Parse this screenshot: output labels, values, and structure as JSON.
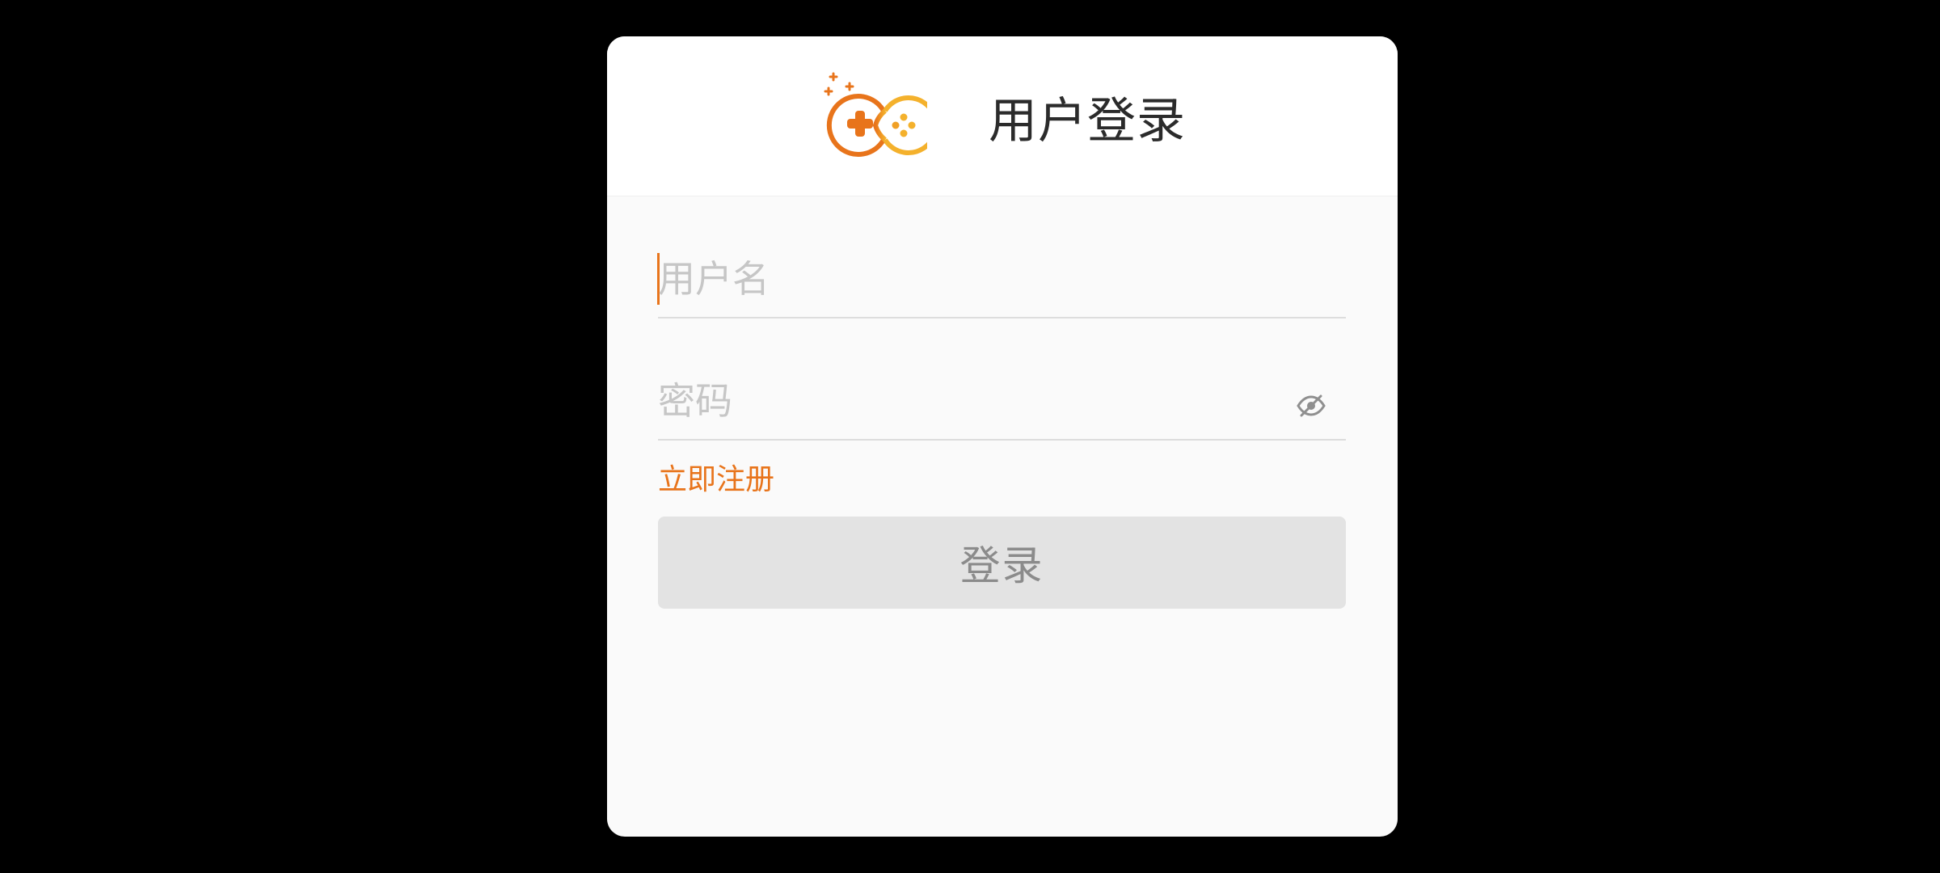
{
  "dialog": {
    "title": "用户登录",
    "logo_icon": "game-controller-logo-icon"
  },
  "form": {
    "username_placeholder": "用户名",
    "password_placeholder": "密码",
    "password_visibility_icon": "eye-off-icon",
    "register_label": "立即注册",
    "login_label": "登录"
  },
  "colors": {
    "accent": "#e8741b",
    "logo_orange": "#e8741b",
    "logo_yellow": "#f4b12c",
    "background": "#000000",
    "dialog_background": "#fafafa",
    "button_disabled": "#e3e3e3"
  }
}
